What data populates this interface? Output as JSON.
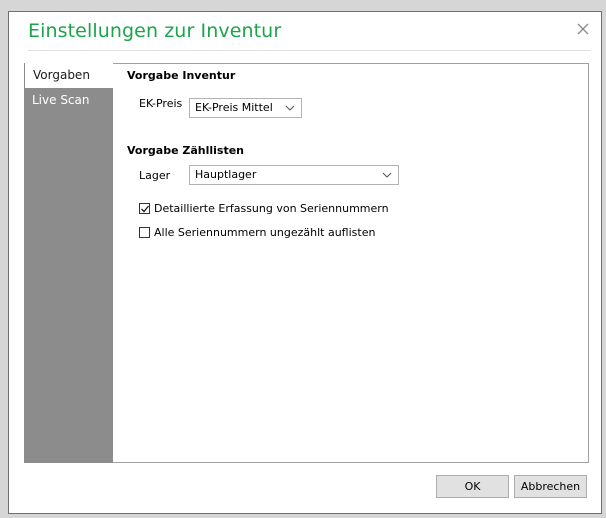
{
  "dialog": {
    "title": "Einstellungen zur Inventur",
    "close_icon": "close-icon",
    "accent_color": "#1aa54a"
  },
  "sidebar": {
    "items": [
      {
        "label": "Vorgaben",
        "active": true
      },
      {
        "label": "Live Scan",
        "active": false
      }
    ]
  },
  "vorgabe_inventur": {
    "heading": "Vorgabe Inventur",
    "ek_label": "EK-Preis",
    "ek_value": "EK-Preis Mittel"
  },
  "vorgabe_zaehllisten": {
    "heading": "Vorgabe Zähllisten",
    "lager_label": "Lager",
    "lager_value": "Hauptlager",
    "check1_label": "Detaillierte Erfassung von Seriennummern",
    "check1_checked": true,
    "check2_label": "Alle Seriennummern ungezählt auflisten",
    "check2_checked": false
  },
  "footer": {
    "ok_label": "OK",
    "cancel_label": "Abbrechen"
  }
}
